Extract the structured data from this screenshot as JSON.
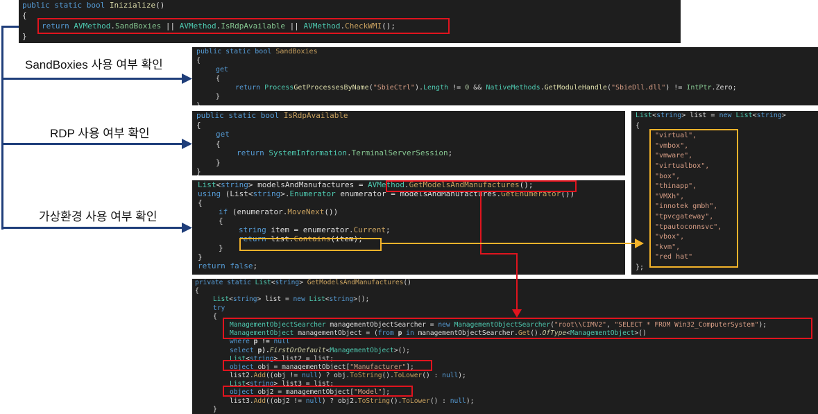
{
  "labels": {
    "sandboxies": "SandBoxies 사용 여부 확인",
    "rdp": "RDP 사용 여부 확인",
    "virtual_env": "가상환경 사용 여부 확인"
  },
  "colors": {
    "panel_bg": "#1e1e1e",
    "keyword": "#569cd6",
    "type": "#4ec9b0",
    "method": "#dcdcaa",
    "string": "#d69d85",
    "red_highlight": "#e0141e",
    "yellow_highlight": "#f3b32b",
    "arrow_blue": "#1f3e7a"
  },
  "panel1": {
    "l1": {
      "a": "public static bool ",
      "b": "Inizialize",
      "c": "()"
    },
    "l2": "{",
    "l3": {
      "a": "return ",
      "b": "AVMethod",
      "c": ".",
      "d": "SandBoxies",
      "e": " || ",
      "f": "AVMethod",
      "g": ".",
      "h": "IsRdpAvailable",
      "i": " || ",
      "j": "AVMethod",
      "k": ".",
      "l": "CheckWMI",
      "m": "();"
    },
    "l4": "}"
  },
  "panel2": {
    "l1": {
      "a": "public static bool ",
      "b": "SandBoxies"
    },
    "l2": "{",
    "l3": "get",
    "l4": "{",
    "l5": {
      "a": "return ",
      "b": "Process",
      ".": ".",
      "c": "GetProcessesByName",
      "d": "(",
      "e": "\"SbieCtrl\"",
      "f": ").",
      "g": "Length",
      "h": " != ",
      "i": "0",
      "j": " && ",
      "k": "NativeMethods",
      "l": ".",
      "m": "GetModuleHandle",
      "n": "(",
      "o": "\"SbieDll.dll\"",
      "p": ") != ",
      "q": "IntPtr",
      "r": ".Zero;"
    },
    "l6": "}",
    "l7": "}"
  },
  "panel3": {
    "l1": {
      "a": "public static bool ",
      "b": "IsRdpAvailable"
    },
    "l2": "{",
    "l3": "get",
    "l4": "{",
    "l5": {
      "a": "return ",
      "b": "SystemInformation",
      "c": ".",
      "d": "TerminalServerSession",
      "e": ";"
    },
    "l6": "}",
    "l7": "}"
  },
  "panel4": {
    "l1": {
      "a": "List",
      "b": "<",
      "c": "string",
      "d": "> modelsAndManufactures = ",
      "e": "AVMethod",
      "f": ".",
      "g": "GetModelsAndManufactures",
      "h": "();"
    },
    "l2": {
      "a": "using ",
      "b": "(List<",
      "c": "string",
      "d": ">.",
      "e": "Enumerator",
      "f": " enumerator = modelsAndManufactures.",
      "g": "GetEnumerator",
      "h": "())"
    },
    "l3": "{",
    "l4": {
      "a": "if ",
      "b": "(enumerator.",
      "c": "MoveNext",
      "d": "())"
    },
    "l5": "{",
    "l6": {
      "a": "string ",
      "b": "item = enumerator.",
      "c": "Current",
      "d": ";"
    },
    "l7": {
      "a": "return ",
      "b": "list.",
      "c": "Contains",
      "d": "(item);"
    },
    "l8": "}",
    "l9": "}",
    "l10": {
      "a": "return ",
      "b": "false",
      "c": ";"
    }
  },
  "panel5": {
    "l1": {
      "a": "List",
      "b": "<",
      "c": "string",
      "d": "> list = ",
      "e": "new ",
      "f": "List",
      "g": "<",
      "h": "string",
      "i": ">"
    },
    "l2": "{",
    "items": [
      "\"virtual\",",
      "\"vmbox\",",
      "\"vmware\",",
      "\"virtualbox\",",
      "\"box\",",
      "\"thinapp\",",
      "\"VMXh\",",
      "\"innotek gmbh\",",
      "\"tpvcgateway\",",
      "\"tpautoconnsvc\",",
      "\"vbox\",",
      "\"kvm\",",
      "\"red hat\""
    ],
    "l_end": "};"
  },
  "panel6": {
    "l1": {
      "a": "private static ",
      "b": "List",
      "c": "<",
      "d": "string",
      "e": "> ",
      "f": "GetModelsAndManufactures",
      "g": "()"
    },
    "l2": "{",
    "l3": {
      "a": "List",
      "b": "<",
      "c": "string",
      "d": "> list = ",
      "e": "new ",
      "f": "List",
      "g": "<",
      "h": "string",
      "i": ">();"
    },
    "l4": "try",
    "l5": "{",
    "l6": {
      "a": "ManagementObjectSearcher",
      "b": " managementObjectSearcher = ",
      "c": "new ",
      "d": "ManagementObjectSearcher",
      "e": "(",
      "f": "\"root\\\\CIMV2\"",
      "g": ", ",
      "h": "\"SELECT * FROM Win32_ComputerSystem\"",
      "i": ");"
    },
    "l7": {
      "a": "ManagementObject",
      "b": " managementObject = (",
      "c": "from ",
      "d": "p ",
      "e": "in ",
      "f": "managementObjectSearcher.",
      "g": "Get",
      "h": "().",
      "i": "OfType",
      "j": "<",
      "k": "ManagementObject",
      "l": ">()"
    },
    "l8": {
      "a": "where ",
      "b": "p != ",
      "c": "null"
    },
    "l9": {
      "a": "select ",
      "b": "p).",
      "c": "FirstOrDefault",
      "d": "<",
      "e": "ManagementObject",
      "f": ">();"
    },
    "l10": {
      "a": "List",
      "b": "<",
      "c": "string",
      "d": "> list2 = list;"
    },
    "l11": {
      "a": "object ",
      "b": "obj = managementObject[",
      "c": "\"Manufacturer\"",
      "d": "];"
    },
    "l12": {
      "a": "list2.",
      "b": "Add",
      "c": "((obj != ",
      "d": "null",
      "e": ") ? obj.",
      "f": "ToString",
      "g": "().",
      "h": "ToLower",
      "i": "() : ",
      "j": "null",
      "k": ");"
    },
    "l13": {
      "a": "List",
      "b": "<",
      "c": "string",
      "d": "> list3 = list;"
    },
    "l14": {
      "a": "object ",
      "b": "obj2 = managementObject[",
      "c": "\"Model\"",
      "d": "];"
    },
    "l15": {
      "a": "list3.",
      "b": "Add",
      "c": "((obj2 != ",
      "d": "null",
      "e": ") ? obj2.",
      "f": "ToString",
      "g": "().",
      "h": "ToLower",
      "i": "() : ",
      "j": "null",
      "k": ");"
    },
    "l16": "}"
  }
}
